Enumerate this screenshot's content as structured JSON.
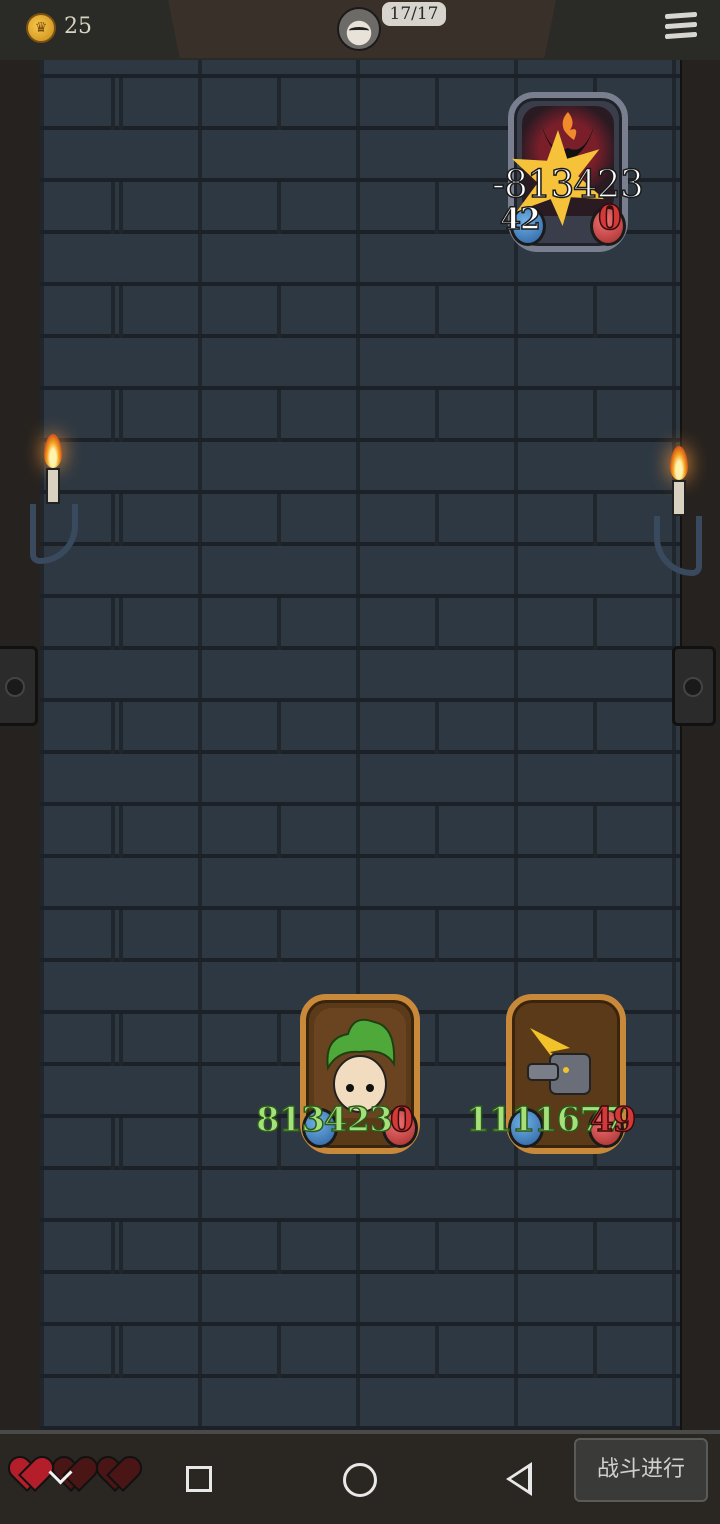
{
  "header": {
    "gold_icon": "crown-coin-icon",
    "gold": "25",
    "turn_counter": "17/17",
    "menu_icon": "hamburger-menu-icon"
  },
  "enemy": {
    "damage_popup": "-813423",
    "attack": "42",
    "health": "0"
  },
  "allies": [
    {
      "portrait": "leaf-girl",
      "attack": "813423",
      "health": "0"
    },
    {
      "portrait": "armored-knight",
      "attack": "1111677",
      "health": "49"
    }
  ],
  "footer": {
    "lives_full": 1,
    "lives_total": 3,
    "battle_button": "战斗进行"
  },
  "colors": {
    "attack_text": "#a5e07a",
    "health_text": "#d23a3a",
    "gold_frame": "#c88a3a",
    "enemy_frame": "#7a7f90"
  }
}
